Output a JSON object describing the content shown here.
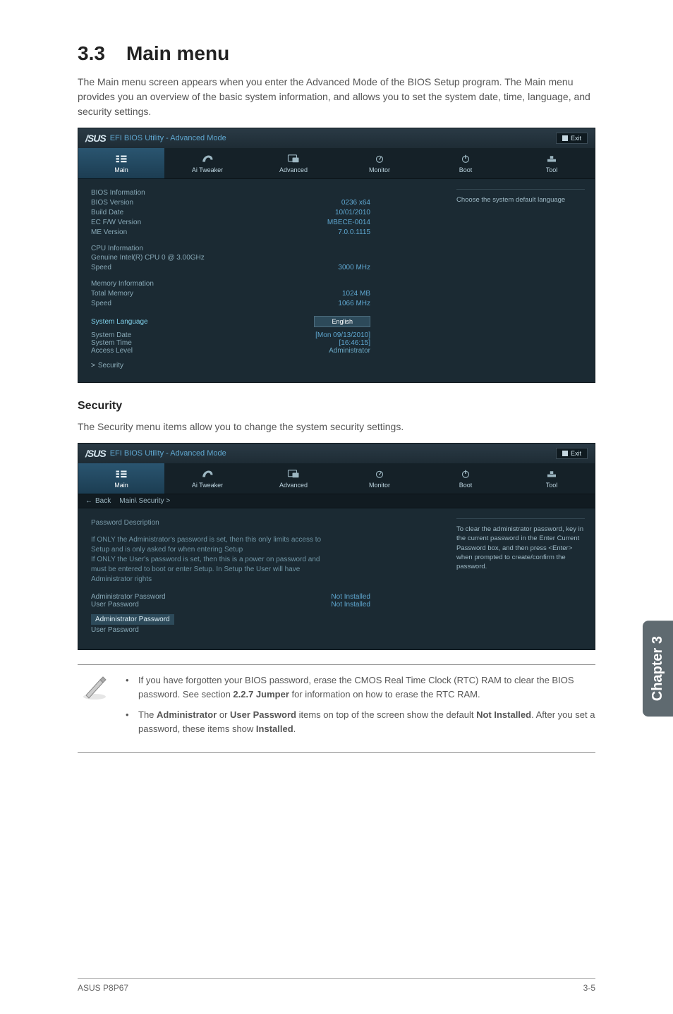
{
  "section": {
    "number": "3.3",
    "title": "Main menu"
  },
  "intro_text": "The Main menu screen appears when you enter the Advanced Mode of the BIOS Setup program. The Main menu provides you an overview of the basic system information, and allows you to set the system date, time, language, and security settings.",
  "bios_common": {
    "brand": "/SUS",
    "title": "EFI BIOS Utility - Advanced Mode",
    "exit": "Exit",
    "tabs": [
      "Main",
      "Ai Tweaker",
      "Advanced",
      "Monitor",
      "Boot",
      "Tool"
    ]
  },
  "main_panel": {
    "help_text": "Choose the system default language",
    "bios_info": {
      "heading": "BIOS Information",
      "rows": [
        {
          "k": "BIOS Version",
          "v": "0236 x64"
        },
        {
          "k": "Build Date",
          "v": "10/01/2010"
        },
        {
          "k": "EC F/W Version",
          "v": "MBECE-0014"
        },
        {
          "k": "ME Version",
          "v": "7.0.0.1115"
        }
      ]
    },
    "cpu_info": {
      "heading": "CPU Information",
      "sub": "Genuine Intel(R) CPU 0 @ 3.00GHz",
      "rows": [
        {
          "k": "Speed",
          "v": "3000 MHz"
        }
      ]
    },
    "mem_info": {
      "heading": "Memory Information",
      "rows": [
        {
          "k": "Total Memory",
          "v": "1024 MB"
        },
        {
          "k": "Speed",
          "v": "1066 MHz"
        }
      ]
    },
    "language": {
      "label": "System Language",
      "value": "English"
    },
    "state": [
      {
        "k": "System Date",
        "v": "[Mon 09/13/2010]"
      },
      {
        "k": "System Time",
        "v": "[16:46:15]"
      },
      {
        "k": "Access Level",
        "v": "Administrator"
      }
    ],
    "collapse": "Security"
  },
  "security_section": {
    "heading": "Security",
    "intro": "The Security menu items allow you to change the system security settings.",
    "breadcrumb_back": "Back",
    "breadcrumb_path": "Main\\ Security >",
    "help_text": "To clear the administrator password, key in the current password in the Enter Current Password box, and then press <Enter> when prompted to create/confirm the password.",
    "desc_heading": "Password Description",
    "desc_body": "If ONLY the Administrator's password is set, then this only limits access to Setup and is only asked for when entering Setup\nIf ONLY the User's password is set, then this is a power on password and must be entered to boot or enter Setup. In Setup the User will have Administrator rights",
    "pwd_rows": [
      {
        "k": "Administrator Password",
        "v": "Not Installed"
      },
      {
        "k": "User Password",
        "v": "Not Installed"
      }
    ],
    "items": [
      {
        "label": "Administrator Password",
        "highlight": true
      },
      {
        "label": "User Password",
        "highlight": false
      }
    ]
  },
  "notes": {
    "b1_pre": "If you have forgotten your BIOS password, erase the CMOS Real Time Clock (RTC) RAM to clear the BIOS password. See section ",
    "b1_bold": "2.2.7 Jumper",
    "b1_post": " for information on how to erase the RTC RAM.",
    "b2_pre": "The ",
    "b2_admin": "Administrator",
    "b2_or": " or ",
    "b2_user": "User Password",
    "b2_mid": " items on top of the screen show the default ",
    "b2_ni": "Not Installed",
    "b2_after": ". After you set a password, these items show ",
    "b2_inst": "Installed",
    "b2_end": "."
  },
  "side_tab": "Chapter 3",
  "footer": {
    "left": "ASUS P8P67",
    "right": "3-5"
  }
}
